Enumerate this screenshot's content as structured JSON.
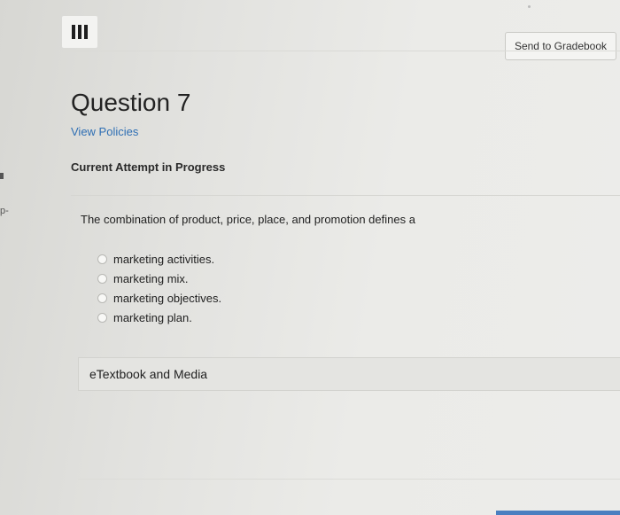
{
  "header": {
    "menu_icon": "hamburger-menu-icon",
    "send_to_gradebook_label": "Send to Gradebook"
  },
  "question": {
    "title": "Question 7",
    "view_policies_label": "View Policies",
    "attempt_status": "Current Attempt in Progress",
    "text": "The combination of product, price, place, and promotion defines a",
    "options": [
      {
        "label": "marketing activities."
      },
      {
        "label": "marketing mix."
      },
      {
        "label": "marketing objectives."
      },
      {
        "label": "marketing plan."
      }
    ]
  },
  "resources": {
    "etextbook_label": "eTextbook and Media"
  },
  "side": {
    "fragment_text": "p-"
  },
  "colors": {
    "link": "#2f6fb4",
    "accent_bar": "#4a7fc0"
  }
}
